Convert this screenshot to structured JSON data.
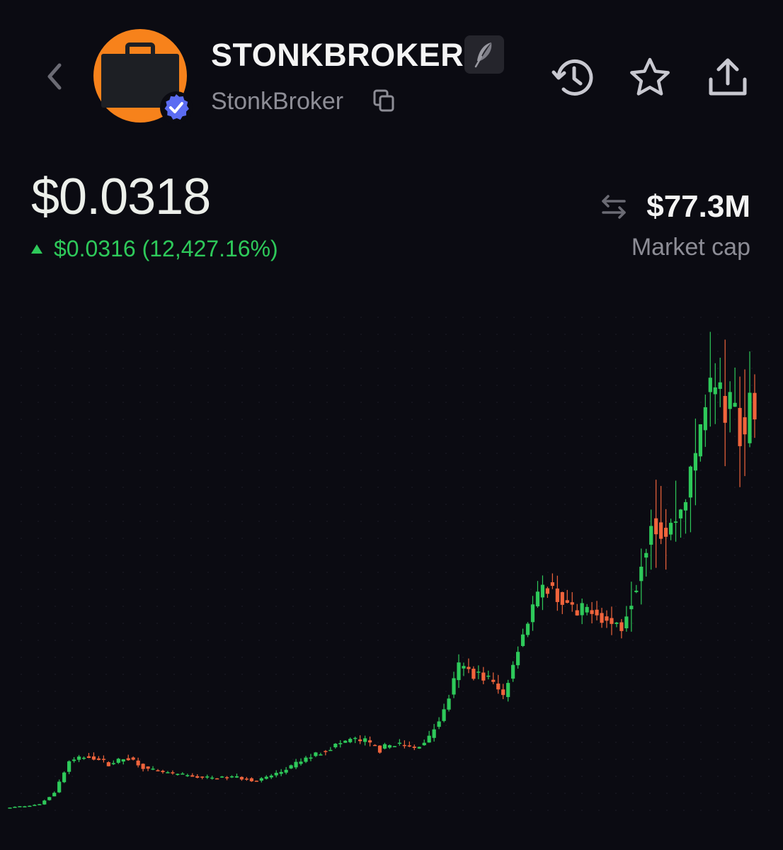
{
  "header": {
    "token_name": "STONKBROKER",
    "handle": "StonkBroker",
    "icons": [
      "back-chevron-icon",
      "briefcase-avatar",
      "verified-badge-icon",
      "quill-icon",
      "copy-icon",
      "history-icon",
      "star-icon",
      "share-icon"
    ]
  },
  "price": {
    "current": "$0.0318",
    "change": "$0.0316 (12,427.16%)",
    "direction": "up"
  },
  "market_cap": {
    "value": "$77.3M",
    "label": "Market cap"
  },
  "colors": {
    "background": "#0b0b12",
    "up": "#2ec95a",
    "down": "#f0643c",
    "avatar": "#f7821b",
    "verified": "#5b6cf2"
  },
  "chart_data": {
    "type": "candlestick",
    "grid": true,
    "trend": "up",
    "title": "",
    "xlabel": "",
    "ylabel": "",
    "anchors": [
      [
        0,
        0.0007
      ],
      [
        6,
        0.001
      ],
      [
        9,
        0.0022
      ],
      [
        12,
        0.0052
      ],
      [
        16,
        0.0058
      ],
      [
        20,
        0.005
      ],
      [
        24,
        0.0056
      ],
      [
        28,
        0.0044
      ],
      [
        33,
        0.004
      ],
      [
        40,
        0.0036
      ],
      [
        46,
        0.0037
      ],
      [
        50,
        0.0033
      ],
      [
        55,
        0.0042
      ],
      [
        60,
        0.0055
      ],
      [
        65,
        0.0066
      ],
      [
        69,
        0.0074
      ],
      [
        72,
        0.0072
      ],
      [
        75,
        0.0064
      ],
      [
        78,
        0.007
      ],
      [
        82,
        0.0065
      ],
      [
        85,
        0.0076
      ],
      [
        88,
        0.0102
      ],
      [
        91,
        0.0145
      ],
      [
        94,
        0.014
      ],
      [
        97,
        0.0134
      ],
      [
        100,
        0.0117
      ],
      [
        103,
        0.0165
      ],
      [
        106,
        0.0205
      ],
      [
        109,
        0.0225
      ],
      [
        112,
        0.021
      ],
      [
        115,
        0.0195
      ],
      [
        118,
        0.0205
      ],
      [
        121,
        0.019
      ],
      [
        124,
        0.0185
      ],
      [
        127,
        0.023
      ],
      [
        130,
        0.029
      ],
      [
        133,
        0.0275
      ],
      [
        136,
        0.03
      ],
      [
        139,
        0.035
      ],
      [
        141,
        0.042
      ],
      [
        143,
        0.0418
      ],
      [
        145,
        0.0398
      ],
      [
        147,
        0.0396
      ],
      [
        149,
        0.0372
      ],
      [
        150,
        0.0422
      ],
      [
        151,
        0.0395
      ]
    ]
  }
}
